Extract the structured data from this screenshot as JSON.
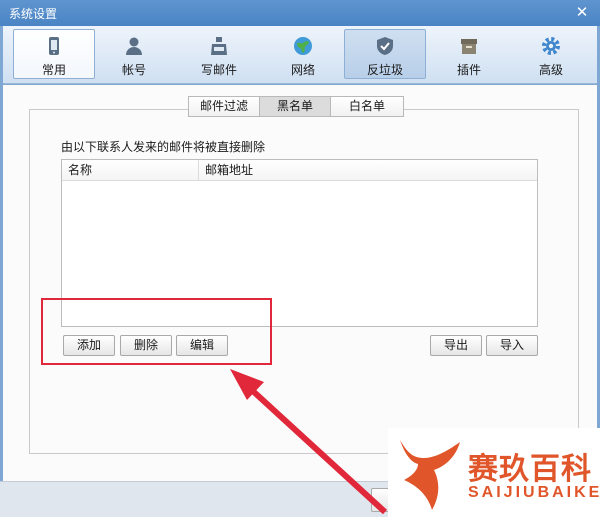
{
  "window": {
    "title": "系统设置",
    "close_symbol": "✕"
  },
  "toolbar": {
    "items": [
      {
        "label": "常用",
        "icon": "mobile-icon",
        "state": "selected"
      },
      {
        "label": "帐号",
        "icon": "user-icon",
        "state": "normal"
      },
      {
        "label": "写邮件",
        "icon": "inkwell-icon",
        "state": "normal"
      },
      {
        "label": "网络",
        "icon": "globe-icon",
        "state": "normal"
      },
      {
        "label": "反垃圾",
        "icon": "shield-icon",
        "state": "highlighted"
      },
      {
        "label": "插件",
        "icon": "box-icon",
        "state": "normal"
      },
      {
        "label": "高级",
        "icon": "gear-icon",
        "state": "normal"
      }
    ]
  },
  "tabs": [
    {
      "label": "邮件过滤",
      "active": false
    },
    {
      "label": "黑名单",
      "active": true
    },
    {
      "label": "白名单",
      "active": false
    }
  ],
  "blacklist": {
    "description": "由以下联系人发来的邮件将被直接删除",
    "columns": [
      "名称",
      "邮箱地址"
    ],
    "rows": []
  },
  "buttons": {
    "add": "添加",
    "delete": "删除",
    "edit": "编辑",
    "export": "导出",
    "import": "导入"
  },
  "annotation": {
    "color": "#e0283a"
  },
  "watermark": {
    "title": "赛玖百科",
    "subtitle": "SAIJIUBAIKE",
    "color": "#e0562a"
  },
  "colors": {
    "titlebar": "#4a84c4",
    "toolbar_bg": "#dbe8f5",
    "accent_red": "#e0283a"
  }
}
